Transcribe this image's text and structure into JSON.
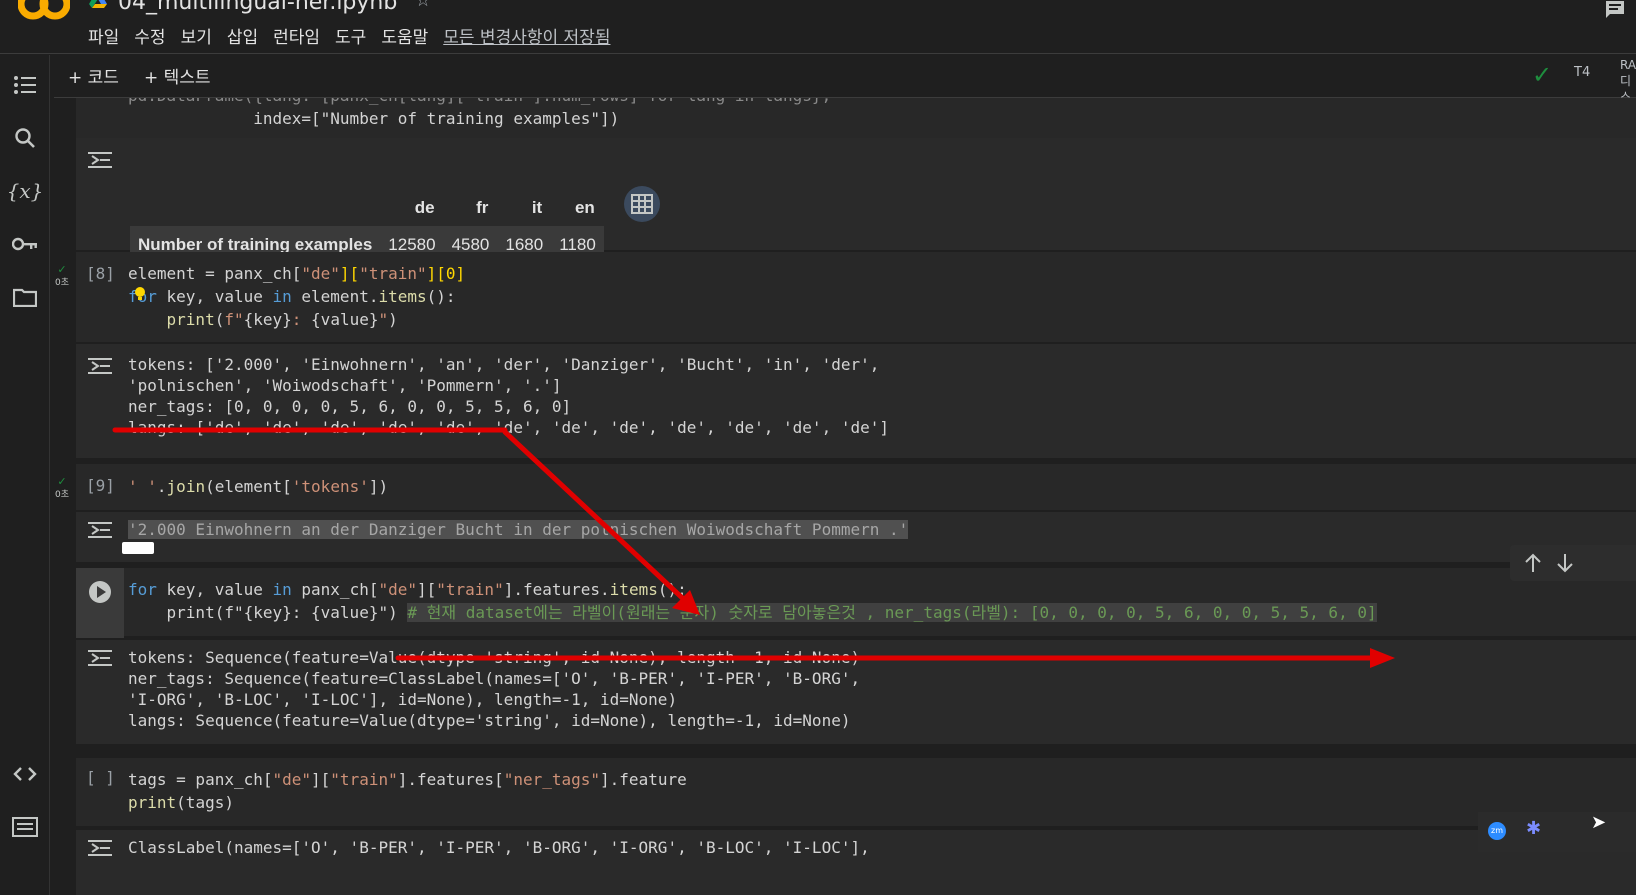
{
  "title_bar": {
    "notebook_title": "04_multilingual-ner.ipynb"
  },
  "menu": {
    "items": [
      "파일",
      "수정",
      "보기",
      "삽입",
      "런타임",
      "도구",
      "도움말"
    ],
    "saved_status": "모든 변경사항이 저장됨"
  },
  "toolbar": {
    "add_code": "+ 코드",
    "add_text": "+ 텍스트",
    "runtime": "T4",
    "ram_label_1": "RA",
    "ram_label_2": "디스크"
  },
  "cells": {
    "c0": {
      "code_line1": "pd.DataFrame({lang: [panx_ch[lang][\"train\"].num_rows] for lang in langs},",
      "code_line2": "             index=[\"Number of training examples\"])",
      "df_columns": [
        "de",
        "fr",
        "it",
        "en"
      ],
      "df_row_label": "Number of training examples",
      "df_values": [
        "12580",
        "4580",
        "1680",
        "1180"
      ]
    },
    "c1": {
      "exec_count": "[8]",
      "time": "0초",
      "code_line1": "element = panx_ch[\"de\"][\"train\"][0]",
      "code_line2": "for key, value in element.items():",
      "code_line3": "    print(f\"{key}: {value}\")",
      "out_line1": "tokens: ['2.000', 'Einwohnern', 'an', 'der', 'Danziger', 'Bucht', 'in', 'der',",
      "out_line2": "'polnischen', 'Woiwodschaft', 'Pommern', '.']",
      "out_line3": "ner_tags: [0, 0, 0, 0, 5, 6, 0, 0, 5, 5, 6, 0]",
      "out_line4": "langs: ['de', 'de', 'de', 'de', 'de', 'de', 'de', 'de', 'de', 'de', 'de', 'de']"
    },
    "c2": {
      "exec_count": "[9]",
      "time": "0초",
      "code_line1": "' '.join(element['tokens'])",
      "out_line1": "'2.000 Einwohnern an der Danziger Bucht in der polnischen Woiwodschaft Pommern .'"
    },
    "c3": {
      "code_line1": "for key, value in panx_ch[\"de\"][\"train\"].features.items():",
      "code_line2_a": "    print(f\"{key}: {value}\") ",
      "code_line2_comment": "# 현재 dataset에는 라벨이(원래는 문자) 숫자로 담아놓은것 , ner_tags(라벨): [0, 0, 0, 0, 5, 6, 0, 0, 5, 5, 6, 0]",
      "out_line1": "tokens: Sequence(feature=Value(dtype='string', id=None), length=-1, id=None)",
      "out_line2": "ner_tags: Sequence(feature=ClassLabel(names=['O', 'B-PER', 'I-PER', 'B-ORG',",
      "out_line3": "'I-ORG', 'B-LOC', 'I-LOC'], id=None), length=-1, id=None)",
      "out_line4": "langs: Sequence(feature=Value(dtype='string', id=None), length=-1, id=None)"
    },
    "c4": {
      "exec_count": "[ ]",
      "code_line1": "tags = panx_ch[\"de\"][\"train\"].features[\"ner_tags\"].feature",
      "code_line2": "print(tags)",
      "out_line1": "ClassLabel(names=['O', 'B-PER', 'I-PER', 'B-ORG', 'I-ORG', 'B-LOC', 'I-LOC'],"
    }
  },
  "colors": {
    "background": "#1f1f1f",
    "cell_bg": "#282828",
    "annotation_red": "#e00000",
    "success_green": "#1e8e3e"
  }
}
